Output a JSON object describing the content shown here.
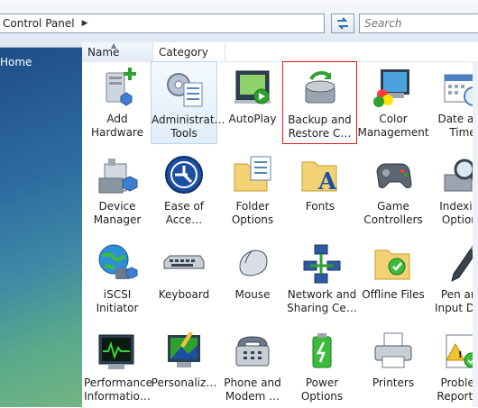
{
  "address": {
    "crumb": "Control Panel",
    "arrow": "▶"
  },
  "search": {
    "placeholder": "Search"
  },
  "left_pane": {
    "home_link": "Home"
  },
  "columns": {
    "name": "Name",
    "category": "Category"
  },
  "items": [
    {
      "label": "Add\nHardware",
      "icon": "add-hardware-icon"
    },
    {
      "label": "Administrat…\nTools",
      "icon": "administrative-tools-icon"
    },
    {
      "label": "AutoPlay",
      "icon": "autoplay-icon"
    },
    {
      "label": "Backup and\nRestore C…",
      "icon": "backup-restore-icon"
    },
    {
      "label": "Color\nManagement",
      "icon": "color-management-icon"
    },
    {
      "label": "Date and\nTime",
      "icon": "date-time-icon"
    },
    {
      "label": "Device\nManager",
      "icon": "device-manager-icon"
    },
    {
      "label": "Ease of\nAcce…",
      "icon": "ease-of-access-icon"
    },
    {
      "label": "Folder\nOptions",
      "icon": "folder-options-icon"
    },
    {
      "label": "Fonts",
      "icon": "fonts-icon"
    },
    {
      "label": "Game\nControllers",
      "icon": "game-controllers-icon"
    },
    {
      "label": "Indexing\nOptions",
      "icon": "indexing-options-icon"
    },
    {
      "label": "iSCSI Initiator",
      "icon": "iscsi-initiator-icon"
    },
    {
      "label": "Keyboard",
      "icon": "keyboard-icon"
    },
    {
      "label": "Mouse",
      "icon": "mouse-icon"
    },
    {
      "label": "Network and\nSharing Ce…",
      "icon": "network-sharing-icon"
    },
    {
      "label": "Offline Files",
      "icon": "offline-files-icon"
    },
    {
      "label": "Pen and\nInput Devi",
      "icon": "pen-input-icon"
    },
    {
      "label": "Performance\nInformatio…",
      "icon": "performance-icon"
    },
    {
      "label": "Personaliz…",
      "icon": "personalization-icon"
    },
    {
      "label": "Phone and\nModem …",
      "icon": "phone-modem-icon"
    },
    {
      "label": "Power\nOptions",
      "icon": "power-options-icon"
    },
    {
      "label": "Printers",
      "icon": "printers-icon"
    },
    {
      "label": "Problem\nReports a",
      "icon": "problem-reports-icon"
    }
  ],
  "colors": {
    "selection_border": "#b8d6ef",
    "highlight_border": "#d91c1c"
  }
}
